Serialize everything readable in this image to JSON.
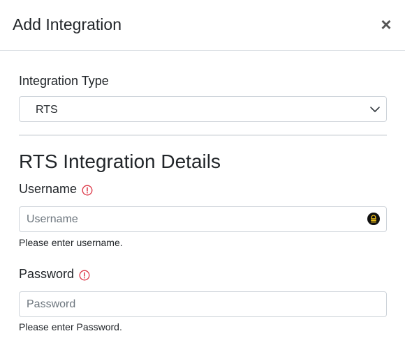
{
  "header": {
    "title": "Add Integration",
    "close_glyph": "×",
    "close_icon": "close-icon"
  },
  "integration_type": {
    "label": "Integration Type",
    "selected": "RTS",
    "chevron_icon": "chevron-down-icon"
  },
  "section": {
    "title": "RTS Integration Details"
  },
  "username": {
    "label": "Username",
    "required_icon": "warning-circle-icon",
    "value": "",
    "placeholder": "Username",
    "help": "Please enter username.",
    "password_manager_icon": "password-manager-icon"
  },
  "password": {
    "label": "Password",
    "required_icon": "warning-circle-icon",
    "value": "",
    "placeholder": "Password",
    "help": "Please enter Password."
  },
  "colors": {
    "required": "#dc3545",
    "border": "#ced4da",
    "text": "#212529",
    "placeholder": "#6c757d"
  }
}
